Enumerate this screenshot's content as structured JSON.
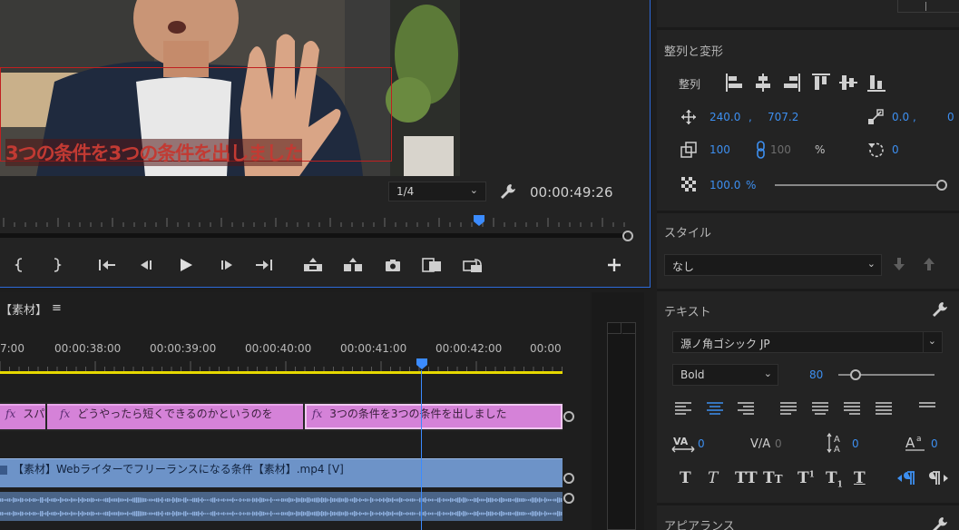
{
  "program_monitor": {
    "caption": "3つの条件を3つの条件を出しました",
    "zoom_level": "1/4",
    "timecode": "00:00:49:26"
  },
  "timeline": {
    "sequence_tab": "【素材】",
    "menu_icon": "≡",
    "ruler_labels": [
      "7:00",
      "00:00:38:00",
      "00:00:39:00",
      "00:00:40:00",
      "00:00:41:00",
      "00:00:42:00",
      "00:00"
    ],
    "title_clips": [
      {
        "fx": "fx",
        "label": "スパ"
      },
      {
        "fx": "fx",
        "label": "どうやったら短くできるのかというのを"
      },
      {
        "fx": "fx",
        "label": "3つの条件を3つの条件を出しました"
      }
    ],
    "video_clip": "【素材】Webライターでフリーランスになる条件【素材】.mp4 [V]"
  },
  "essential_graphics": {
    "align_transform": {
      "heading": "整列と変形",
      "align_label": "整列",
      "position_x": "240.0",
      "position_sep": ",",
      "position_y": "707.2",
      "anchor_x": "0.0",
      "anchor_sep": ",",
      "anchor_y": "0",
      "scale": "100",
      "scale_linked": "100",
      "scale_unit": "%",
      "rotation": "0",
      "opacity": "100.0",
      "opacity_unit": "%"
    },
    "style": {
      "heading": "スタイル",
      "selected": "なし"
    },
    "text": {
      "heading": "テキスト",
      "font": "源ノ角ゴシック JP",
      "weight": "Bold",
      "size": "80",
      "tracking": "0",
      "kerning": "0",
      "leading": "0",
      "baseline": "0"
    },
    "appearance": {
      "heading": "アピアランス"
    }
  },
  "colors": {
    "accent": "#3d8ff0",
    "title_clip": "#d582d8",
    "video_clip": "#6d93c8",
    "audio_clip": "#4a6487",
    "work_area": "#e6d800",
    "panel_focus": "#2d6ad8"
  }
}
